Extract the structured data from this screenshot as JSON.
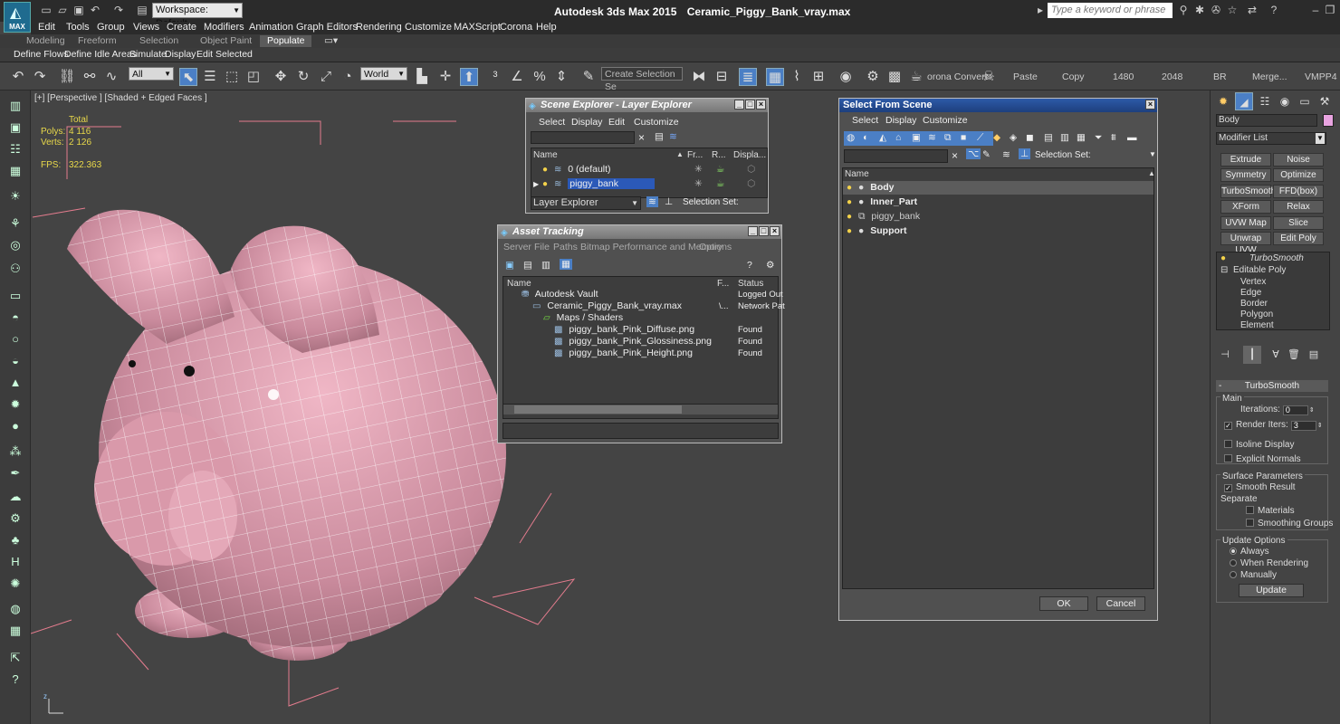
{
  "app": {
    "logo_label": "MAX",
    "title_app": "Autodesk 3ds Max  2015",
    "title_file": "Ceramic_Piggy_Bank_vray.max",
    "workspace": "Workspace: Default",
    "search_placeholder": "Type a keyword or phrase"
  },
  "menu": [
    "Edit",
    "Tools",
    "Group",
    "Views",
    "Create",
    "Modifiers",
    "Animation",
    "Graph Editors",
    "Rendering",
    "Customize",
    "MAXScript",
    "Corona",
    "Help"
  ],
  "ribbon": {
    "tabs": [
      "Modeling",
      "Freeform",
      "Selection",
      "Object Paint",
      "Populate"
    ],
    "active_tab": "Populate",
    "buttons": [
      "Define Flows",
      "Define Idle Areas",
      "Simulate",
      "Display",
      "Edit Selected"
    ]
  },
  "toolbar": {
    "filter": "All",
    "coord_system": "World",
    "selection_set_placeholder": "Create Selection Se",
    "corona_convert": "orona Convert",
    "paste": "Paste",
    "copy": "Copy",
    "width": "1480",
    "height": "2048",
    "br": "BR",
    "merge": "Merge...",
    "vmpp": "VMPP4"
  },
  "viewport": {
    "label": "[+] [Perspective ] [Shaded + Edged Faces ]",
    "stats_total_label": "Total",
    "polys_label": "Polys:",
    "polys_value": "4 116",
    "verts_label": "Verts:",
    "verts_value": "2 126",
    "fps_label": "FPS:",
    "fps_value": "322.363",
    "model_color": "#c98a9c"
  },
  "scene_explorer": {
    "title": "Scene Explorer - Layer Explorer",
    "menu": [
      "Select",
      "Display",
      "Edit",
      "Customize"
    ],
    "columns": [
      "Name",
      "Fr...",
      "R...",
      "Displa..."
    ],
    "rows": [
      {
        "name": "0 (default)",
        "selected": false
      },
      {
        "name": "piggy_bank",
        "selected": true
      }
    ],
    "explorer_type": "Layer Explorer",
    "selection_set_label": "Selection Set:"
  },
  "asset_tracking": {
    "title": "Asset Tracking",
    "menu": [
      "Server",
      "File",
      "Paths",
      "Bitmap Performance and Memory",
      "Options"
    ],
    "columns": [
      "Name",
      "F...",
      "Status"
    ],
    "rows": [
      {
        "name": "Autodesk Vault",
        "f": "",
        "status": "Logged Out"
      },
      {
        "name": "Ceramic_Piggy_Bank_vray.max",
        "f": "\\...",
        "status": "Network Pat"
      },
      {
        "name": "Maps / Shaders",
        "f": "",
        "status": ""
      },
      {
        "name": "piggy_bank_Pink_Diffuse.png",
        "f": "",
        "status": "Found"
      },
      {
        "name": "piggy_bank_Pink_Glossiness.png",
        "f": "",
        "status": "Found"
      },
      {
        "name": "piggy_bank_Pink_Height.png",
        "f": "",
        "status": "Found"
      }
    ]
  },
  "select_from_scene": {
    "title": "Select From Scene",
    "menu": [
      "Select",
      "Display",
      "Customize"
    ],
    "selection_set_label": "Selection Set:",
    "column": "Name",
    "rows": [
      {
        "name": "Body",
        "bold": true,
        "highlighted": true
      },
      {
        "name": "Inner_Part",
        "bold": true,
        "highlighted": false
      },
      {
        "name": "piggy_bank",
        "bold": false,
        "highlighted": false
      },
      {
        "name": "Support",
        "bold": true,
        "highlighted": false
      }
    ],
    "ok": "OK",
    "cancel": "Cancel"
  },
  "command_panel": {
    "object_name": "Body",
    "modifier_list": "Modifier List",
    "object_color": "#e8a3e0",
    "modifier_buttons": [
      "Extrude",
      "Noise",
      "Symmetry",
      "Optimize",
      "TurboSmooth",
      "FFD(box)",
      "XForm",
      "Relax",
      "UVW Map",
      "Slice",
      "Unwrap UVW",
      "Edit Poly"
    ],
    "stack": {
      "top_modifier": "TurboSmooth",
      "base": "Editable Poly",
      "subobjects": [
        "Vertex",
        "Edge",
        "Border",
        "Polygon",
        "Element"
      ]
    },
    "rollout_title": "TurboSmooth",
    "main_group": "Main",
    "iterations_label": "Iterations:",
    "iterations": "0",
    "render_iters_label": "Render Iters:",
    "render_iters": "3",
    "isoline_display": "Isoline Display",
    "explicit_normals": "Explicit Normals",
    "surface_group": "Surface Parameters",
    "smooth_result": "Smooth Result",
    "separate_label": "Separate",
    "materials": "Materials",
    "smoothing_groups": "Smoothing Groups",
    "update_group": "Update Options",
    "update_always": "Always",
    "update_when_rendering": "When Rendering",
    "update_manually": "Manually",
    "update_button": "Update"
  }
}
